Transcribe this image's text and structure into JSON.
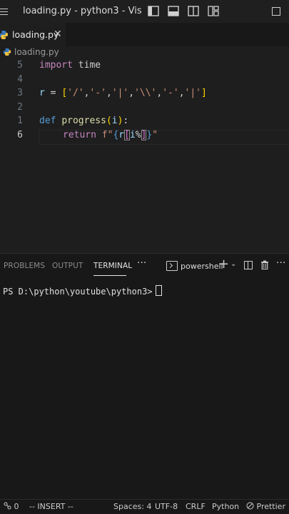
{
  "window": {
    "title": "loading.py - python3 - Vis"
  },
  "tab": {
    "label": "loading.py"
  },
  "breadcrumb": {
    "file": "loading.py"
  },
  "editor": {
    "lines": [
      {
        "num": "5",
        "active": false
      },
      {
        "num": "4",
        "active": false
      },
      {
        "num": "3",
        "active": false
      },
      {
        "num": "2",
        "active": false
      },
      {
        "num": "1",
        "active": false
      },
      {
        "num": "6",
        "active": true
      }
    ],
    "code": {
      "l1": {
        "kw": "import",
        "mod": "time"
      },
      "l3": {
        "var": "r",
        "eq": "=",
        "lb": "[",
        "s1": "'/'",
        "s2": "'-'",
        "s3": "'|'",
        "s4": "'\\\\'",
        "s5": "'-'",
        "s6": "'|'",
        "rb": "]",
        "comma": ","
      },
      "l5": {
        "kw": "def",
        "fn": "progress",
        "lp": "(",
        "param": "i",
        "rp": ")",
        "colon": ":"
      },
      "l6": {
        "kw": "return",
        "fpre": "f\"",
        "lbrace": "{",
        "var": "r",
        "lbr": "[",
        "var2": "i",
        "pct": "%",
        "rbr": "]",
        "rbrace": "}",
        "endq": "\""
      }
    }
  },
  "panel": {
    "tabs": [
      "PROBLEMS",
      "OUTPUT",
      "TERMINAL"
    ],
    "active_tab": "TERMINAL",
    "shell": "powershell",
    "prompt": "PS D:\\python\\youtube\\python3>"
  },
  "status": {
    "ports": "0",
    "mode": "-- INSERT --",
    "spaces": "Spaces: 4",
    "encoding": "UTF-8",
    "eol": "CRLF",
    "language": "Python",
    "formatter": "Prettier"
  },
  "colors": {
    "keyword_import": "#c586c0",
    "keyword_def": "#569cd6",
    "string": "#ce9178",
    "function": "#dcdcaa",
    "variable": "#9cdcfe",
    "bracket": "#ffd700"
  },
  "icons": [
    "menu-icon",
    "python-icon",
    "close-icon",
    "layout-sidebar-icon",
    "layout-panel-icon",
    "layout-split-icon",
    "layout-grid-icon",
    "maximize-icon",
    "terminal-icon",
    "plus-icon",
    "chevron-down-icon",
    "split-terminal-icon",
    "trash-icon",
    "ellipsis-icon",
    "ports-icon",
    "prettier-icon"
  ]
}
